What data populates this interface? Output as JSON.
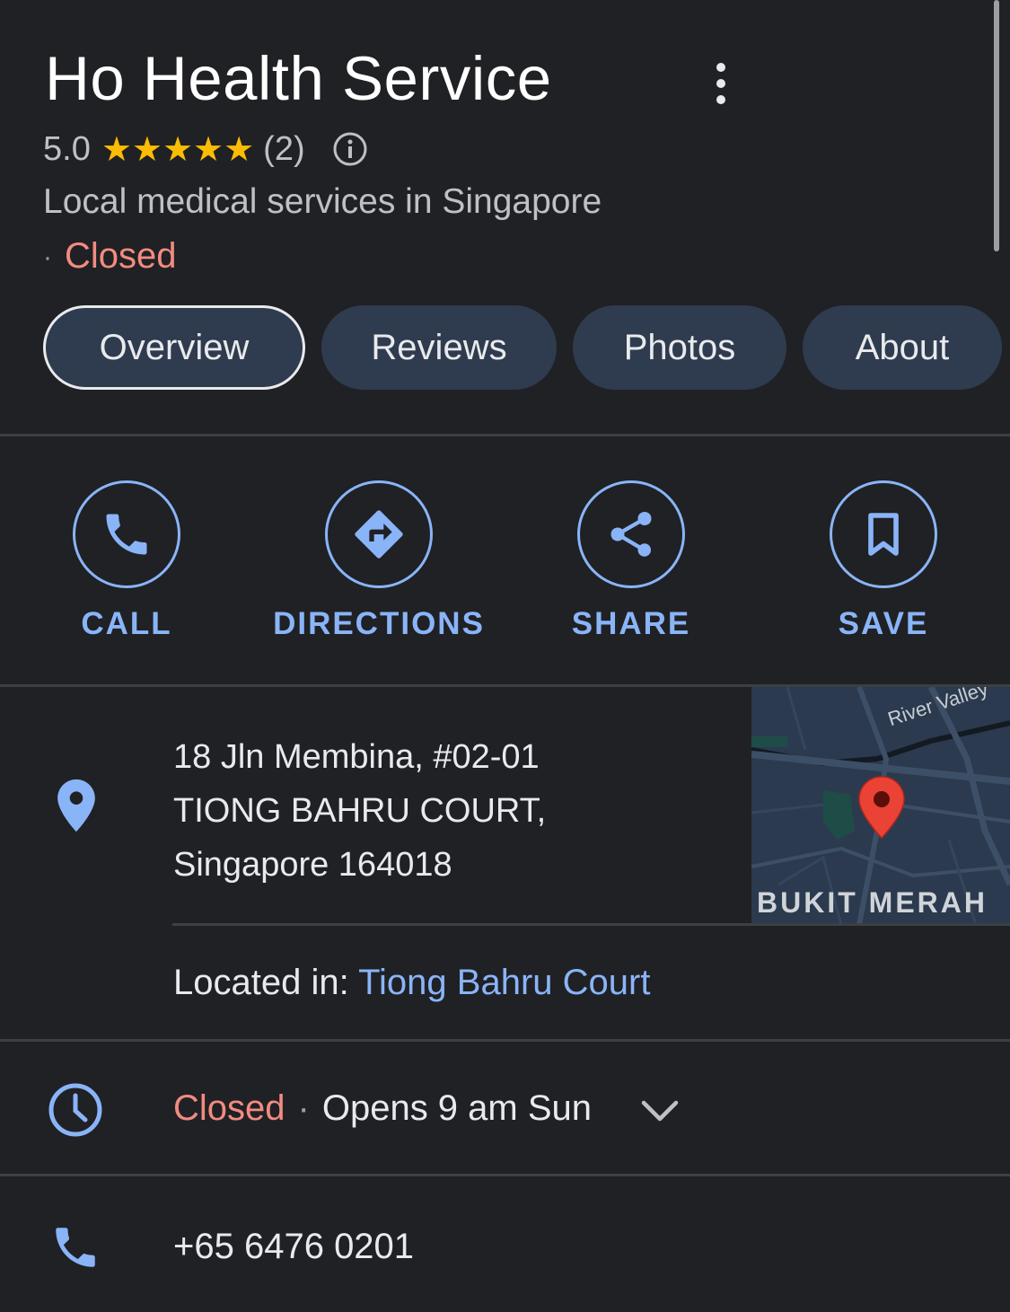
{
  "place": {
    "name": "Ho Health Service",
    "rating": "5.0",
    "stars": "★★★★★",
    "review_count": "(2)",
    "category": "Local medical services in Singapore",
    "status": "Closed"
  },
  "tabs": [
    {
      "label": "Overview",
      "active": true
    },
    {
      "label": "Reviews"
    },
    {
      "label": "Photos"
    },
    {
      "label": "About"
    }
  ],
  "actions": [
    {
      "label": "CALL",
      "icon": "phone-icon"
    },
    {
      "label": "DIRECTIONS",
      "icon": "directions-icon"
    },
    {
      "label": "SHARE",
      "icon": "share-icon"
    },
    {
      "label": "SAVE",
      "icon": "bookmark-icon"
    }
  ],
  "address": {
    "line1": "18 Jln Membina, #02-01",
    "line2": "TIONG BAHRU COURT,",
    "line3": "Singapore 164018"
  },
  "map": {
    "river_label": "River Valley",
    "area_label": "BUKIT MERAH"
  },
  "located_in": {
    "prefix": "Located in: ",
    "link": "Tiong Bahru Court"
  },
  "hours": {
    "status": "Closed",
    "separator": "·",
    "next": "Opens 9 am Sun"
  },
  "phone": "+65 6476 0201",
  "colors": {
    "background": "#202124",
    "accent": "#8ab4f8",
    "closed": "#f28b82",
    "star": "#fbbc04",
    "chip": "#2f3b4e",
    "map_pin": "#ea4335"
  }
}
